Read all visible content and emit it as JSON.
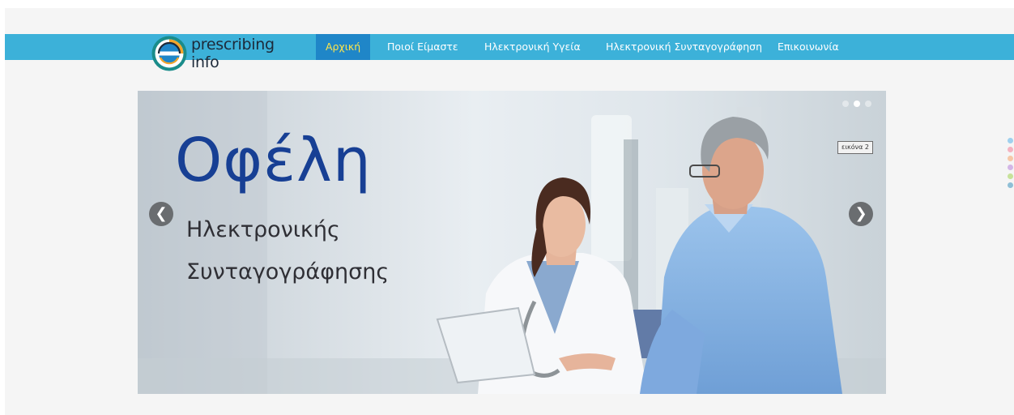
{
  "brand": {
    "name": "prescribing info"
  },
  "nav": {
    "items": [
      {
        "label": "Αρχική",
        "active": true
      },
      {
        "label": "Ποιοί Είμαστε",
        "active": false
      },
      {
        "label": "Ηλεκτρονική Υγεία",
        "active": false
      },
      {
        "label": "Ηλεκτρονική Συνταγογράφηση",
        "active": false
      },
      {
        "label": "Επικοινωνία",
        "active": false
      }
    ]
  },
  "slider": {
    "title": "Οφέλη",
    "subtitle_line1": "Ηλεκτρονικής",
    "subtitle_line2": "Συνταγογράφησης",
    "caption": "εικόνα 2",
    "prev_icon": "❮",
    "next_icon": "❯",
    "current_slide": 2,
    "total_slides": 3
  },
  "colors": {
    "navbar": "#3cb1d9",
    "nav_active_bg": "#1f86c8",
    "nav_active_text": "#ffe54a",
    "title": "#173f94",
    "side_dots": [
      "#9fd0ee",
      "#f4b3c1",
      "#f6c8a8",
      "#d3b6e6",
      "#c7e29a",
      "#8fbfd6"
    ]
  }
}
